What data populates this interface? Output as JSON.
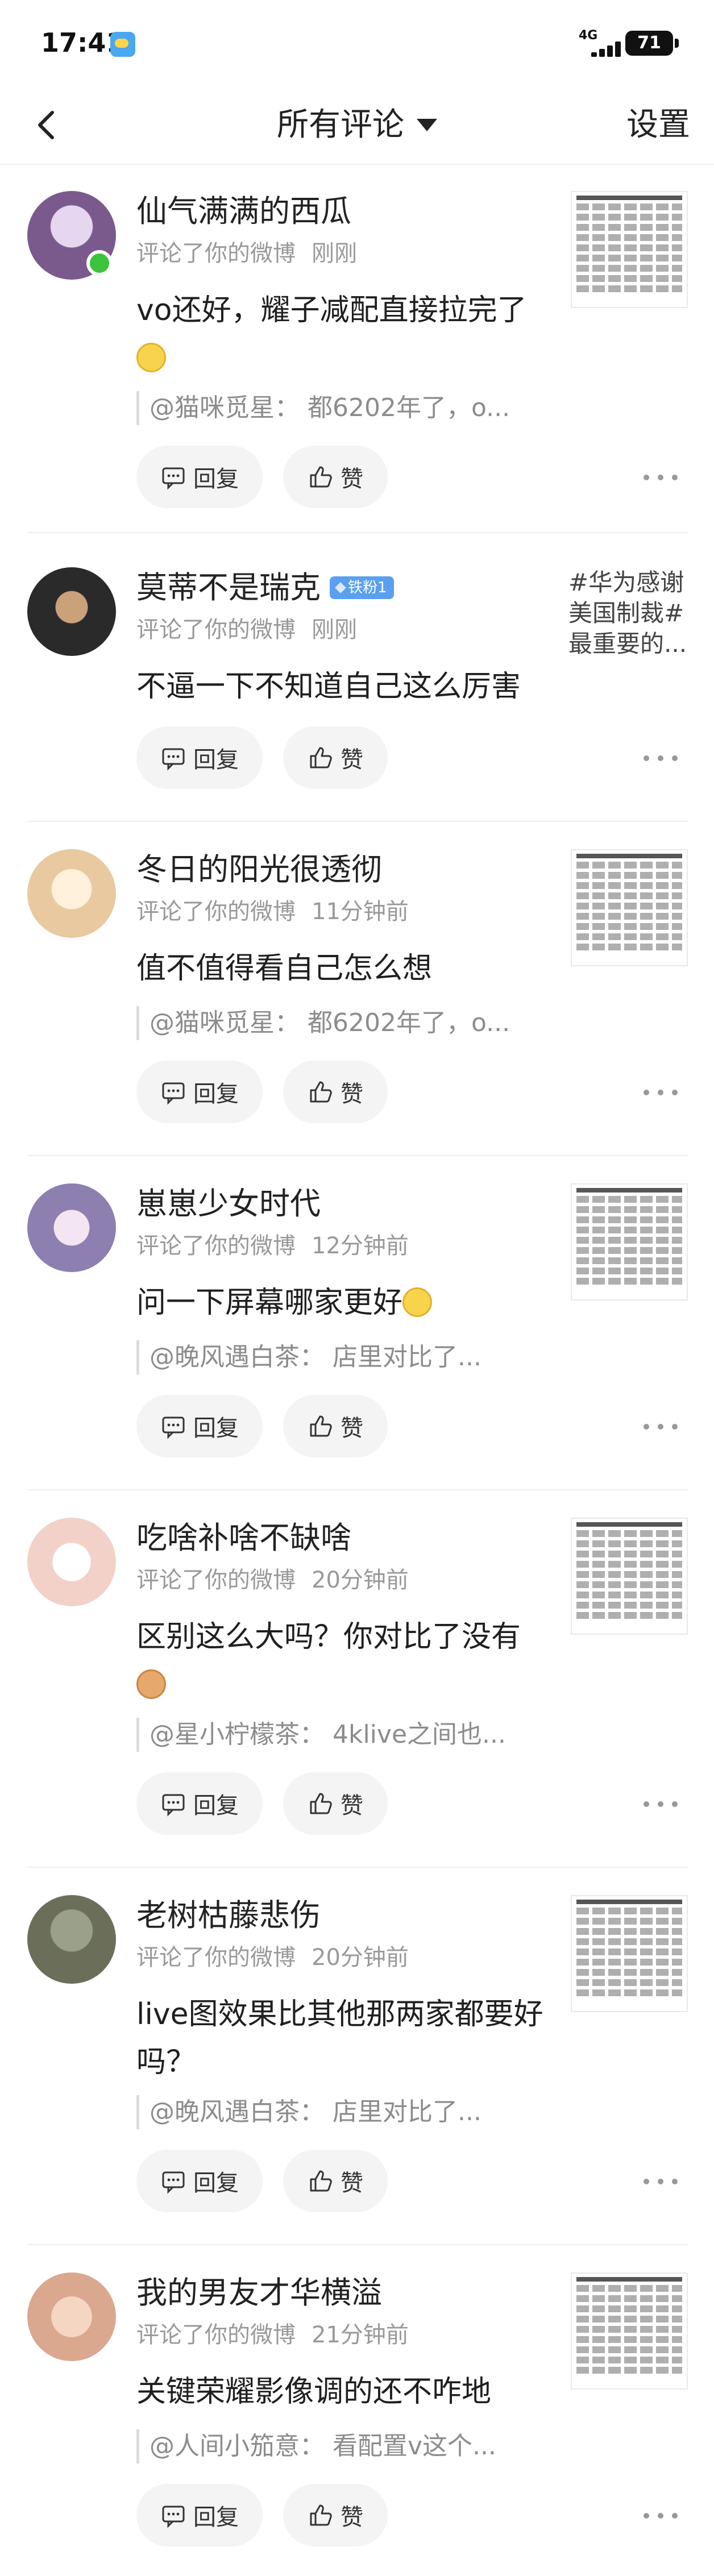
{
  "status_bar": {
    "time": "17:41",
    "network": "4G",
    "battery": "71"
  },
  "header": {
    "title": "所有评论",
    "settings": "设置"
  },
  "actions": {
    "reply": "回复",
    "like": "赞"
  },
  "comments": [
    {
      "username": "仙气满满的西瓜",
      "action": "评论了你的微博",
      "time": "刚刚",
      "text": "vo还好，耀子减配直接拉完了",
      "emoji": "smile-emoji",
      "quote": "@猫咪觅星： 都6202年了，o...",
      "online": true,
      "avatar_color": "#7a5a8c"
    },
    {
      "username": "莫蒂不是瑞克",
      "badge": "铁粉1",
      "action": "评论了你的微博",
      "time": "刚刚",
      "text": "不逼一下不知道自己这么厉害",
      "topic": "#华为感谢美国制裁#最重要的...",
      "avatar_color": "#2a2a2a"
    },
    {
      "username": "冬日的阳光很透彻",
      "action": "评论了你的微博",
      "time": "11分钟前",
      "text": "值不值得看自己怎么想",
      "quote": "@猫咪觅星： 都6202年了，o...",
      "avatar_color": "#e8c9a0"
    },
    {
      "username": "崽崽少女时代",
      "action": "评论了你的微博",
      "time": "12分钟前",
      "text": "问一下屏幕哪家更好",
      "emoji": "shy-emoji",
      "quote": "@晚风遇白茶： 店里对比了...",
      "avatar_color": "#8d7fb0"
    },
    {
      "username": "吃啥补啥不缺啥",
      "action": "评论了你的微博",
      "time": "20分钟前",
      "text": "区别这么大吗？你对比了没有",
      "emoji": "cat-emoji",
      "quote": "@星小柠檬茶： 4klive之间也...",
      "avatar_color": "#f2d2c8"
    },
    {
      "username": "老树枯藤悲伤",
      "action": "评论了你的微博",
      "time": "20分钟前",
      "text": "live图效果比其他那两家都要好吗？",
      "quote": "@晚风遇白茶： 店里对比了...",
      "avatar_color": "#6b6f5a"
    },
    {
      "username": "我的男友才华横溢",
      "action": "评论了你的微博",
      "time": "21分钟前",
      "text": "关键荣耀影像调的还不咋地",
      "quote": "@人间小笳意： 看配置v这个...",
      "avatar_color": "#d9a88f"
    }
  ],
  "icons": {
    "back": "back-arrow-icon",
    "caret": "caret-down-icon",
    "reply": "comment-icon",
    "like": "thumbs-up-icon",
    "more": "more-dots-icon"
  }
}
